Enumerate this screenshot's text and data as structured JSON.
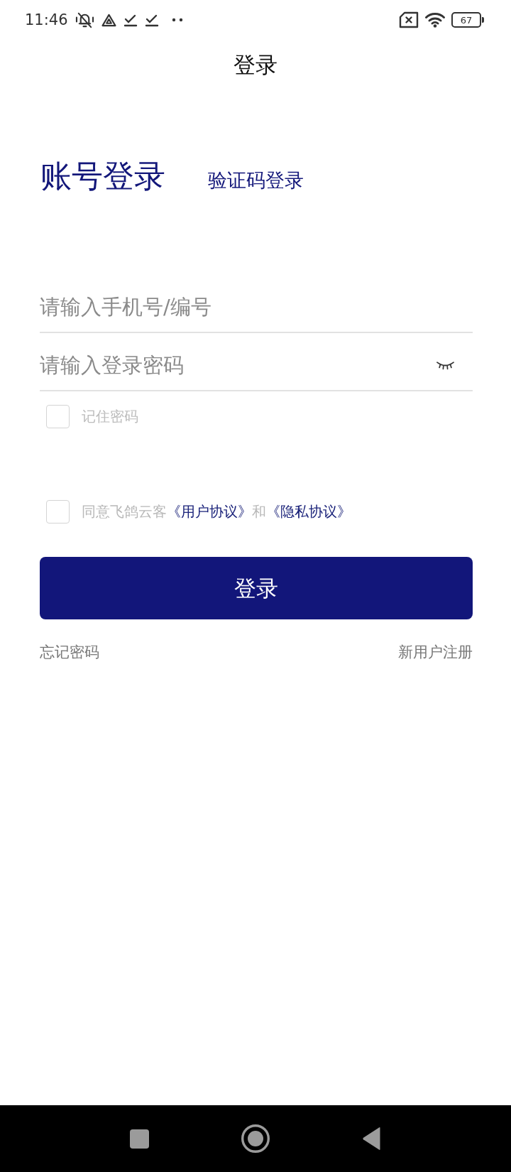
{
  "status_bar": {
    "time": "11:46",
    "battery": "67"
  },
  "header": {
    "title": "登录"
  },
  "tabs": [
    {
      "label": "账号登录",
      "selected": true
    },
    {
      "label": "验证码登录",
      "selected": false
    }
  ],
  "fields": [
    {
      "kind": "account",
      "placeholder": "请输入手机号/编号"
    },
    {
      "kind": "password",
      "placeholder": "请输入登录密码",
      "password_visible": false
    }
  ],
  "remember": {
    "label": "记住密码",
    "checked": false
  },
  "agreement": {
    "checked": false,
    "parts": [
      {
        "kind": "text",
        "text": "同意飞鸽云客"
      },
      {
        "kind": "link",
        "text": "《用户协议》"
      },
      {
        "kind": "text",
        "text": "和"
      },
      {
        "kind": "link",
        "text": "《隐私协议》"
      }
    ]
  },
  "login_button": {
    "label": "登录"
  },
  "links": [
    {
      "label": "忘记密码"
    },
    {
      "label": "新用户注册"
    }
  ]
}
